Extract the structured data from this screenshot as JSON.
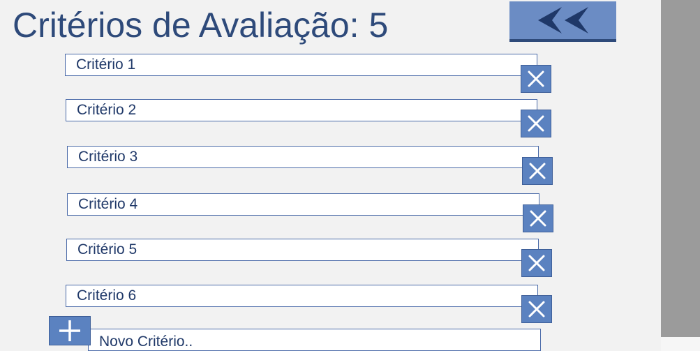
{
  "header": {
    "title": "Critérios de Avaliação: 5",
    "back_icon": "double-chevron-left-icon"
  },
  "criteria": {
    "items": [
      {
        "label": "Critério 1",
        "delete_icon": "close-icon"
      },
      {
        "label": "Critério 2",
        "delete_icon": "close-icon"
      },
      {
        "label": "Critério 3",
        "delete_icon": "close-icon"
      },
      {
        "label": "Critério 4",
        "delete_icon": "close-icon"
      },
      {
        "label": "Critério 5",
        "delete_icon": "close-icon"
      },
      {
        "label": "Critério 6",
        "delete_icon": "close-icon"
      }
    ],
    "new_item_label": "Novo Critério..",
    "add_icon": "plus-icon"
  },
  "colors": {
    "background": "#f2f2f2",
    "title_text": "#2e4a7a",
    "button_fill": "#5b82c0",
    "back_button_fill": "#6b8cc4",
    "border": "#4a6aa8",
    "scrollbar": "#9b9b9b"
  }
}
